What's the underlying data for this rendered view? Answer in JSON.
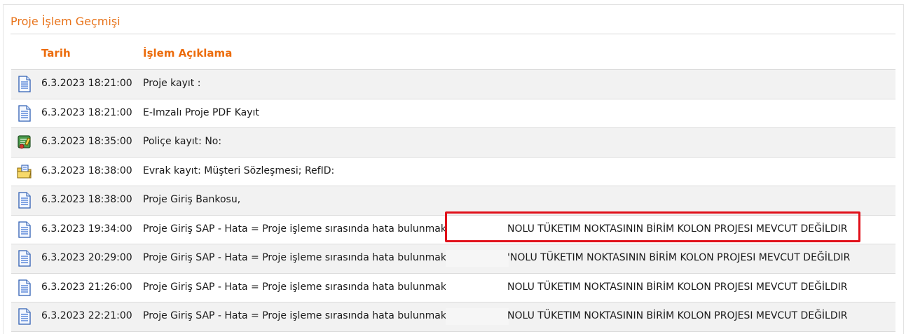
{
  "panel": {
    "title": "Proje İşlem Geçmişi"
  },
  "table": {
    "columns": {
      "date": "Tarih",
      "description": "İşlem Açıklama"
    },
    "rows": [
      {
        "icon": "document-icon",
        "date": "6.3.2023 18:21:00",
        "description": "Proje kayıt :",
        "error": ""
      },
      {
        "icon": "document-icon",
        "date": "6.3.2023 18:21:00",
        "description": "E-Imzalı Proje PDF Kayıt",
        "error": ""
      },
      {
        "icon": "policy-icon",
        "date": "6.3.2023 18:35:00",
        "description": "Poliçe kayıt: No:",
        "error": ""
      },
      {
        "icon": "folder-document-icon",
        "date": "6.3.2023 18:38:00",
        "description": "Evrak kayıt: Müşteri Sözleşmesi; RefID:",
        "error": ""
      },
      {
        "icon": "document-icon",
        "date": "6.3.2023 18:38:00",
        "description": "Proje Giriş Bankosu,",
        "error": ""
      },
      {
        "icon": "document-icon",
        "date": "6.3.2023 19:34:00",
        "description": "Proje Giriş SAP - Hata = Proje işleme sırasında hata bulunmaktadır.",
        "error": "NOLU TÜKETIM NOKTASININ BİRİM KOLON PROJESI MEVCUT DEĞİLDIR"
      },
      {
        "icon": "document-icon",
        "date": "6.3.2023 20:29:00",
        "description": "Proje Giriş SAP - Hata = Proje işleme sırasında hata bulunmaktadır.",
        "error": "'NOLU TÜKETIM NOKTASININ BİRİM KOLON PROJESI MEVCUT DEĞİLDIR"
      },
      {
        "icon": "document-icon",
        "date": "6.3.2023 21:26:00",
        "description": "Proje Giriş SAP - Hata = Proje işleme sırasında hata bulunmaktadır.",
        "error": "NOLU TÜKETIM NOKTASININ BİRİM KOLON PROJESI MEVCUT DEĞİLDIR"
      },
      {
        "icon": "document-icon",
        "date": "6.3.2023 22:21:00",
        "description": "Proje Giriş SAP - Hata = Proje işleme sırasında hata bulunmaktadır.",
        "error": "NOLU TÜKETIM NOKTASININ BİRİM KOLON PROJESI MEVCUT DEĞİLDIR"
      }
    ]
  },
  "colors": {
    "accent": "#ec6c0c",
    "highlight": "#e0101a",
    "row_alt": "#f2f2f2"
  }
}
